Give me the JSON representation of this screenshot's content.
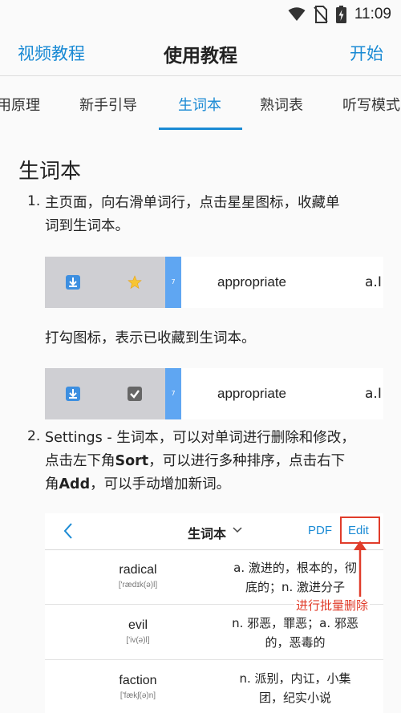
{
  "status": {
    "time": "11:09",
    "icons": [
      "wifi-icon",
      "no-sim-icon",
      "battery-charging-icon"
    ]
  },
  "header": {
    "left_link": "视频教程",
    "title": "使用教程",
    "right_link": "开始"
  },
  "tabs": [
    {
      "label": "用原理",
      "active": false
    },
    {
      "label": "新手引导",
      "active": false
    },
    {
      "label": "生词本",
      "active": true
    },
    {
      "label": "熟词表",
      "active": false
    },
    {
      "label": "听写模式",
      "active": false
    }
  ],
  "content": {
    "section_title": "生词本",
    "step1": {
      "number": "1.",
      "line1": "主页面，向右滑单词行，点击星星图标，收藏单",
      "line2": "词到生词本。"
    },
    "demo_row_1": {
      "badge": "7",
      "word": "appropriate",
      "def": "a.I",
      "icons": [
        "download-icon",
        "star-icon"
      ]
    },
    "caption": "打勾图标，表示已收藏到生词本。",
    "demo_row_2": {
      "badge": "7",
      "word": "appropriate",
      "def": "a.I",
      "icons": [
        "download-icon",
        "checkbox-icon"
      ]
    },
    "step2": {
      "number": "2.",
      "line1": "Settings - 生词本，可以对单词进行删除和修改，",
      "line2_pre": "点击左下角",
      "line2_bold": "Sort",
      "line2_post": "，可以进行多种排序，点击右下",
      "line3_pre": "角",
      "line3_bold": "Add",
      "line3_post": "，可以手动增加新词。"
    },
    "screenshot": {
      "title": "生词本",
      "pdf_label": "PDF",
      "edit_label": "Edit",
      "rows": [
        {
          "word": "radical",
          "phonetic": "['rædɪk(ə)l]",
          "def_line1": "a. 激进的，根本的，彻",
          "def_line2": "底的；n. 激进分子"
        },
        {
          "word": "evil",
          "phonetic": "['iv(ə)l]",
          "def_line1": "n. 邪恶，罪恶；a. 邪恶",
          "def_line2": "的，恶毒的"
        },
        {
          "word": "faction",
          "phonetic": "['fækʃ(ə)n]",
          "def_line1": "n. 派别，内讧，小集",
          "def_line2": "团，纪实小说"
        }
      ]
    },
    "annotation": "进行批量删除"
  }
}
